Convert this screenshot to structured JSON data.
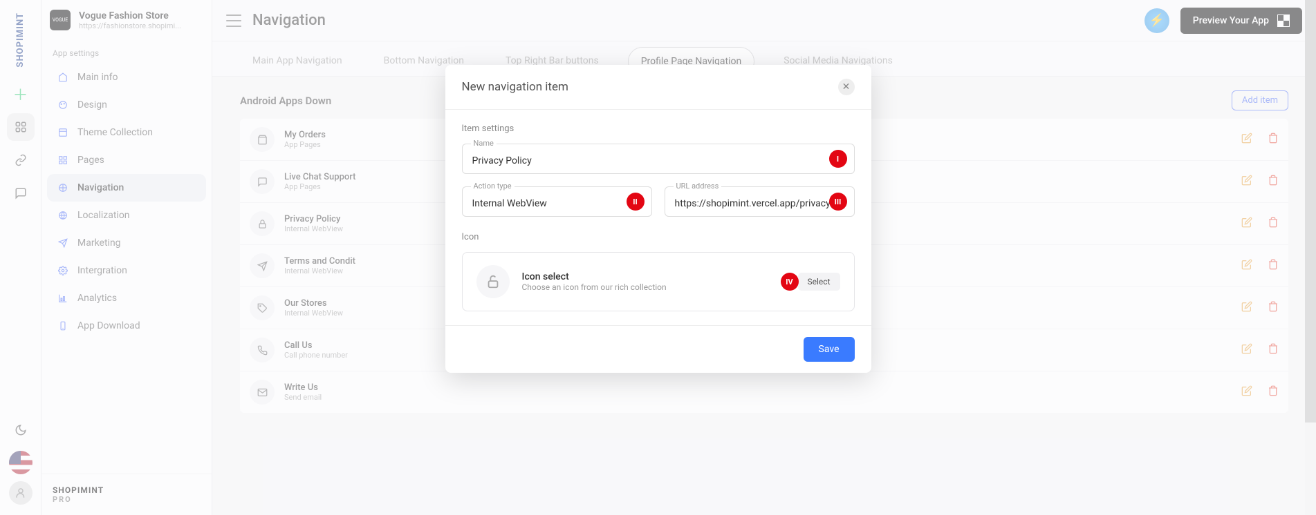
{
  "brand": {
    "title": "Vogue Fashion Store",
    "subtitle": "https://fashionstore.shopimi...",
    "logo_text": "VOGUE"
  },
  "rail_logo": "SHOPIMINT",
  "sidebar": {
    "section": "App settings",
    "items": [
      {
        "label": "Main info"
      },
      {
        "label": "Design"
      },
      {
        "label": "Theme Collection"
      },
      {
        "label": "Pages"
      },
      {
        "label": "Navigation"
      },
      {
        "label": "Localization"
      },
      {
        "label": "Marketing"
      },
      {
        "label": "Intergration"
      },
      {
        "label": "Analytics"
      },
      {
        "label": "App Download"
      }
    ],
    "footer": {
      "brand": "SHOPIMINT",
      "tier": "PRO"
    }
  },
  "topbar": {
    "title": "Navigation",
    "preview": "Preview Your App"
  },
  "tabs": [
    {
      "label": "Main App Navigation"
    },
    {
      "label": "Bottom Navigation"
    },
    {
      "label": "Top Right Bar buttons"
    },
    {
      "label": "Profile Page Navigation"
    },
    {
      "label": "Social Media Navigations"
    }
  ],
  "content": {
    "title": "Android Apps Down",
    "add": "Add item",
    "rows": [
      {
        "title": "My Orders",
        "sub": "App Pages"
      },
      {
        "title": "Live Chat Support",
        "sub": "App Pages"
      },
      {
        "title": "Privacy Policy",
        "sub": "Internal WebView"
      },
      {
        "title": "Terms and Condit",
        "sub": "Internal WebView"
      },
      {
        "title": "Our Stores",
        "sub": "Internal WebView"
      },
      {
        "title": "Call Us",
        "sub": "Call phone number"
      },
      {
        "title": "Write Us",
        "sub": "Send email"
      }
    ]
  },
  "modal": {
    "title": "New navigation item",
    "item_settings": "Item settings",
    "name_label": "Name",
    "name_value": "Privacy Policy",
    "action_label": "Action type",
    "action_value": "Internal WebView",
    "url_label": "URL address",
    "url_value": "https://shopimint.vercel.app/privacy",
    "icon_section": "Icon",
    "icon_title": "Icon select",
    "icon_sub": "Choose an icon from our rich collection",
    "select": "Select",
    "save": "Save",
    "markers": {
      "one": "I",
      "two": "II",
      "three": "III",
      "four": "IV"
    }
  }
}
